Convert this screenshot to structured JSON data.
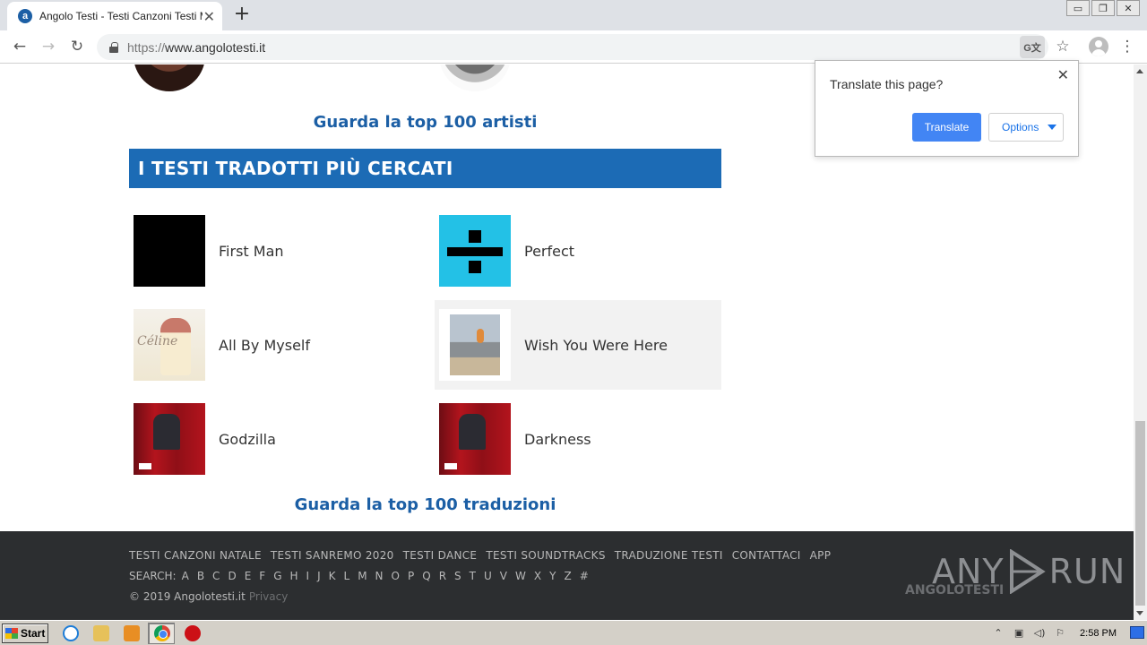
{
  "browser": {
    "tab_title": "Angolo Testi - Testi Canzoni Testi Mu",
    "tab_close": "✕",
    "new_tab": "+",
    "url_scheme": "https://",
    "url_host": "www.angolotesti.it",
    "window_buttons": {
      "minimize": "▭",
      "restore": "❐",
      "close": "✕"
    },
    "icons": [
      "back-arrow-icon",
      "forward-arrow-icon",
      "reload-icon",
      "lock-icon",
      "translate-icon",
      "star-icon",
      "profile-icon",
      "menu-icon"
    ]
  },
  "page": {
    "top_artists_link": "Guarda la top 100 artisti",
    "section_title": "I TESTI TRADOTTI PIÙ CERCATI",
    "songs": [
      {
        "title": "First Man",
        "cover": "black"
      },
      {
        "title": "Perfect",
        "cover": "divide"
      },
      {
        "title": "All By Myself",
        "cover": "celine"
      },
      {
        "title": "Wish You Were Here",
        "cover": "wish-you-were-here"
      },
      {
        "title": "Godzilla",
        "cover": "music-to-be-murdered-by"
      },
      {
        "title": "Darkness",
        "cover": "music-to-be-murdered-by"
      }
    ],
    "top_translations_link": "Guarda la top 100 traduzioni",
    "accent_color": "#1c6bb5"
  },
  "footer": {
    "links": [
      "TESTI CANZONI NATALE",
      "TESTI SANREMO 2020",
      "TESTI DANCE",
      "TESTI SOUNDTRACKS",
      "TRADUZIONE TESTI",
      "CONTATTACI",
      "APP"
    ],
    "search_label": "SEARCH:",
    "letters": [
      "A",
      "B",
      "C",
      "D",
      "E",
      "F",
      "G",
      "H",
      "I",
      "J",
      "K",
      "L",
      "M",
      "N",
      "O",
      "P",
      "Q",
      "R",
      "S",
      "T",
      "U",
      "V",
      "W",
      "X",
      "Y",
      "Z",
      "#"
    ],
    "copyright": "© 2019 Angolotesti.it",
    "privacy": "Privacy",
    "brand_watermark": "ANGOLOTESTI",
    "anyrun_left": "ANY",
    "anyrun_right": "RUN"
  },
  "translate_popup": {
    "question": "Translate this page?",
    "translate_button": "Translate",
    "options_button": "Options",
    "close": "✕",
    "button_color": "#4285f4"
  },
  "taskbar": {
    "start_label": "Start",
    "clock": "2:58 PM"
  }
}
